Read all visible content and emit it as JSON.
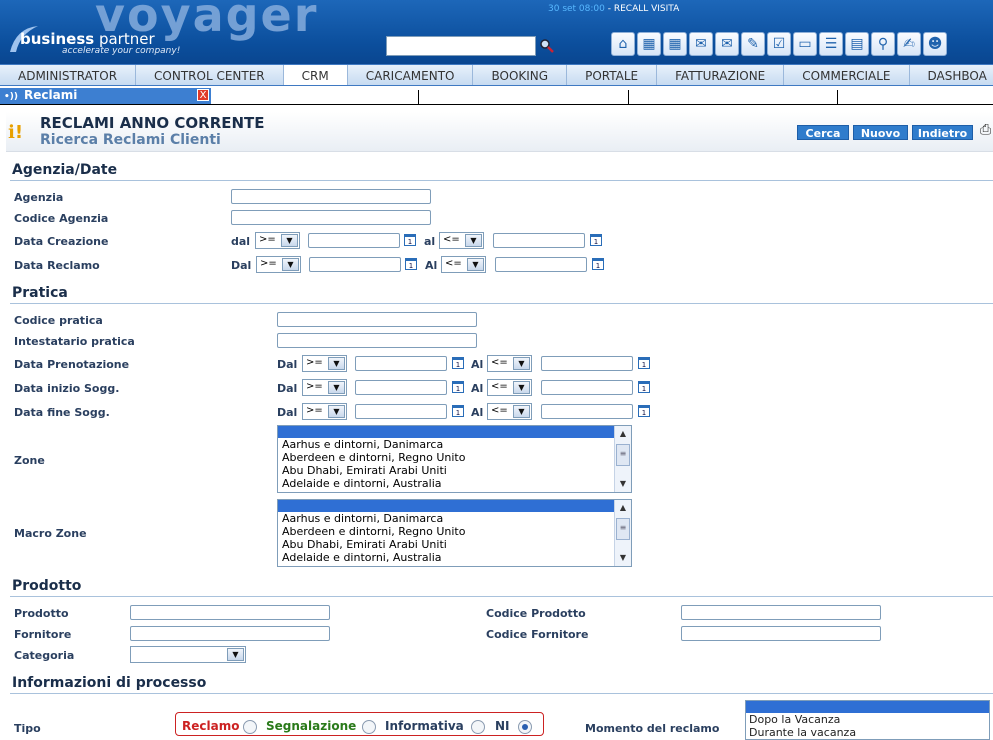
{
  "header": {
    "logo_big": "voyager",
    "logo_bp_bold": "business",
    "logo_bp_rest": " partner",
    "logo_tagline": "accelerate your company!",
    "clock_time": "30 set 08:00",
    "clock_event": " - RECALL VISITA",
    "search_value": "",
    "toolbar_icons": [
      "home-icon",
      "calendar-icon",
      "calendar-add-icon",
      "mail-icon",
      "mail-down-icon",
      "pen-icon",
      "checklist-icon",
      "card-icon",
      "list-icon",
      "calculator-icon",
      "search-icon",
      "notepad-icon",
      "users-icon"
    ]
  },
  "nav": [
    "ADMINISTRATOR",
    "CONTROL CENTER",
    "CRM",
    "CARICAMENTO",
    "BOOKING",
    "PORTALE",
    "FATTURAZIONE",
    "COMMERCIALE",
    "DASHBOA"
  ],
  "tab": {
    "label": "Reclami",
    "close": "X"
  },
  "page": {
    "title": "RECLAMI ANNO CORRENTE",
    "subtitle": "Ricerca Reclami Clienti",
    "buttons": [
      "Cerca",
      "Nuovo",
      "Indietro"
    ]
  },
  "sections": {
    "agenzia": "Agenzia/Date",
    "pratica": "Pratica",
    "prodotto": "Prodotto",
    "processo": "Informazioni di processo"
  },
  "labels": {
    "agenzia": "Agenzia",
    "codice_agenzia": "Codice Agenzia",
    "data_creazione": "Data Creazione",
    "data_reclamo": "Data Reclamo",
    "codice_pratica": "Codice pratica",
    "intestatario": "Intestatario pratica",
    "data_prenotazione": "Data Prenotazione",
    "data_inizio": "Data inizio Sogg.",
    "data_fine": "Data fine Sogg.",
    "zone": "Zone",
    "macro_zone": "Macro Zone",
    "prodotto": "Prodotto",
    "fornitore": "Fornitore",
    "categoria": "Categoria",
    "codice_prodotto": "Codice Prodotto",
    "codice_fornitore": "Codice Fornitore",
    "tipo": "Tipo",
    "momento": "Momento del reclamo"
  },
  "range_words": {
    "dal_lower": "dal",
    "al_lower": "al",
    "dal": "Dal",
    "al": "Al"
  },
  "operators": {
    "from": ">=",
    "to": "<="
  },
  "calendar_glyph": "1",
  "zone_options": [
    "Aarhus e dintorni, Danimarca",
    "Aberdeen e dintorni, Regno Unito",
    "Abu Dhabi, Emirati Arabi Uniti",
    "Adelaide e dintorni, Australia"
  ],
  "macro_zone_options": [
    "Aarhus e dintorni, Danimarca",
    "Aberdeen e dintorni, Regno Unito",
    "Abu Dhabi, Emirati Arabi Uniti",
    "Adelaide e dintorni, Australia"
  ],
  "tipo_options": [
    "Reclamo",
    "Segnalazione",
    "Informativa",
    "NI"
  ],
  "tipo_selected": "NI",
  "momento_options": [
    "Dopo la Vacanza",
    "Durante la vacanza"
  ],
  "colors": {
    "topbar": "#0b4e9c",
    "accent": "#2f7ccc",
    "reclamo": "#cc2222",
    "segnalazione": "#2a7a1a"
  }
}
